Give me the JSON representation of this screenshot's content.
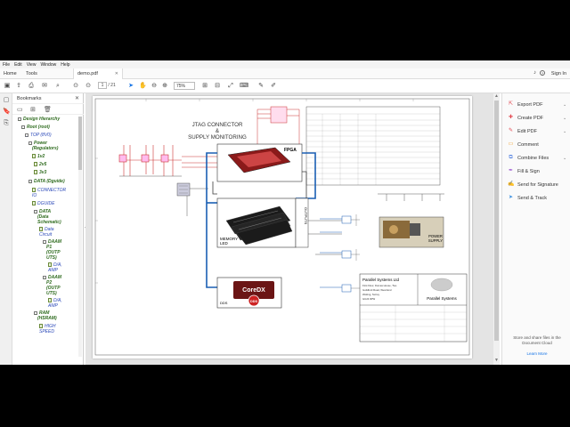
{
  "menu": [
    "File",
    "Edit",
    "View",
    "Window",
    "Help"
  ],
  "tabs": {
    "home": "Home",
    "tools": "Tools",
    "document": "demo.pdf",
    "sign_in": "Sign In"
  },
  "toolbar": {
    "page_current": "1",
    "page_total": "/ 21",
    "zoom": "75%"
  },
  "bookmarks": {
    "title": "Bookmarks",
    "items": [
      {
        "label": "Design Hierarchy",
        "style": "green"
      },
      {
        "label": "Root (root)",
        "style": "green"
      },
      {
        "label": "TOP (8V0)",
        "style": "blue"
      },
      {
        "label": "Power",
        "style": "green"
      },
      {
        "label": "(Regulators)",
        "style": "green"
      },
      {
        "label": "1v2",
        "style": "green"
      },
      {
        "label": "2v5",
        "style": "green"
      },
      {
        "label": "3v3",
        "style": "green"
      },
      {
        "label": "DATA (Dguide)",
        "style": "green"
      },
      {
        "label": "CONNECTOR",
        "style": "blue"
      },
      {
        "label": "IO",
        "style": "blue"
      },
      {
        "label": "DGUIDE",
        "style": "blue"
      },
      {
        "label": "DATA",
        "style": "green"
      },
      {
        "label": "(Data",
        "style": "green"
      },
      {
        "label": "Schematic)",
        "style": "green"
      },
      {
        "label": "Data",
        "style": "blue"
      },
      {
        "label": "Circuit",
        "style": "blue"
      },
      {
        "label": "DAAM",
        "style": "green"
      },
      {
        "label": "P1",
        "style": "green"
      },
      {
        "label": "(OUTP",
        "style": "green"
      },
      {
        "label": "UTS)",
        "style": "green"
      },
      {
        "label": "D/A,",
        "style": "blue"
      },
      {
        "label": "AMP",
        "style": "blue"
      },
      {
        "label": "DAAM",
        "style": "green"
      },
      {
        "label": "P2",
        "style": "green"
      },
      {
        "label": "(OUTP",
        "style": "green"
      },
      {
        "label": "UTS)",
        "style": "green"
      },
      {
        "label": "D/A,",
        "style": "blue"
      },
      {
        "label": "AMP",
        "style": "blue"
      },
      {
        "label": "RAM",
        "style": "green"
      },
      {
        "label": "(HSRAM)",
        "style": "green"
      },
      {
        "label": "HIGH",
        "style": "blue"
      },
      {
        "label": "SPEED",
        "style": "blue"
      }
    ]
  },
  "schematic": {
    "jtag_title": "JTAG CONNECTOR",
    "amp": "&",
    "supply_title": "SUPPLY MONITORING",
    "fpga": "FPGA",
    "memory": "MEMORY",
    "led": "LED",
    "outputs": "OUTPUTS",
    "coredx": "CoreDX",
    "dds": "DDS",
    "dds_label": "DDS",
    "power_supply": "POWER",
    "supply": "SUPPLY",
    "company": "Parallel Systems Ltd",
    "company_lines": [
      "First Floor, Dumas House, Two",
      "Guildford Road, West End",
      "Woking, Surrey",
      "GU24 9PW"
    ],
    "logo_text": "Parallel Systems"
  },
  "right_panel": {
    "tools": [
      {
        "label": "Export PDF",
        "icon": "export-pdf-icon",
        "color": "#e34850",
        "chevron": true
      },
      {
        "label": "Create PDF",
        "icon": "create-pdf-icon",
        "color": "#e34850",
        "chevron": true
      },
      {
        "label": "Edit PDF",
        "icon": "edit-pdf-icon",
        "color": "#e34850",
        "chevron": true
      },
      {
        "label": "Comment",
        "icon": "comment-icon",
        "color": "#f0a030",
        "chevron": false
      },
      {
        "label": "Combine Files",
        "icon": "combine-files-icon",
        "color": "#4a7be0",
        "chevron": true
      },
      {
        "label": "Fill & Sign",
        "icon": "fill-sign-icon",
        "color": "#9b59d0",
        "chevron": false
      },
      {
        "label": "Send for Signature",
        "icon": "send-signature-icon",
        "color": "#9b59d0",
        "chevron": false
      },
      {
        "label": "Send & Track",
        "icon": "send-track-icon",
        "color": "#3a8fe0",
        "chevron": false
      }
    ],
    "footer": "Store and share files in the Document Cloud",
    "learn_more": "Learn More"
  }
}
